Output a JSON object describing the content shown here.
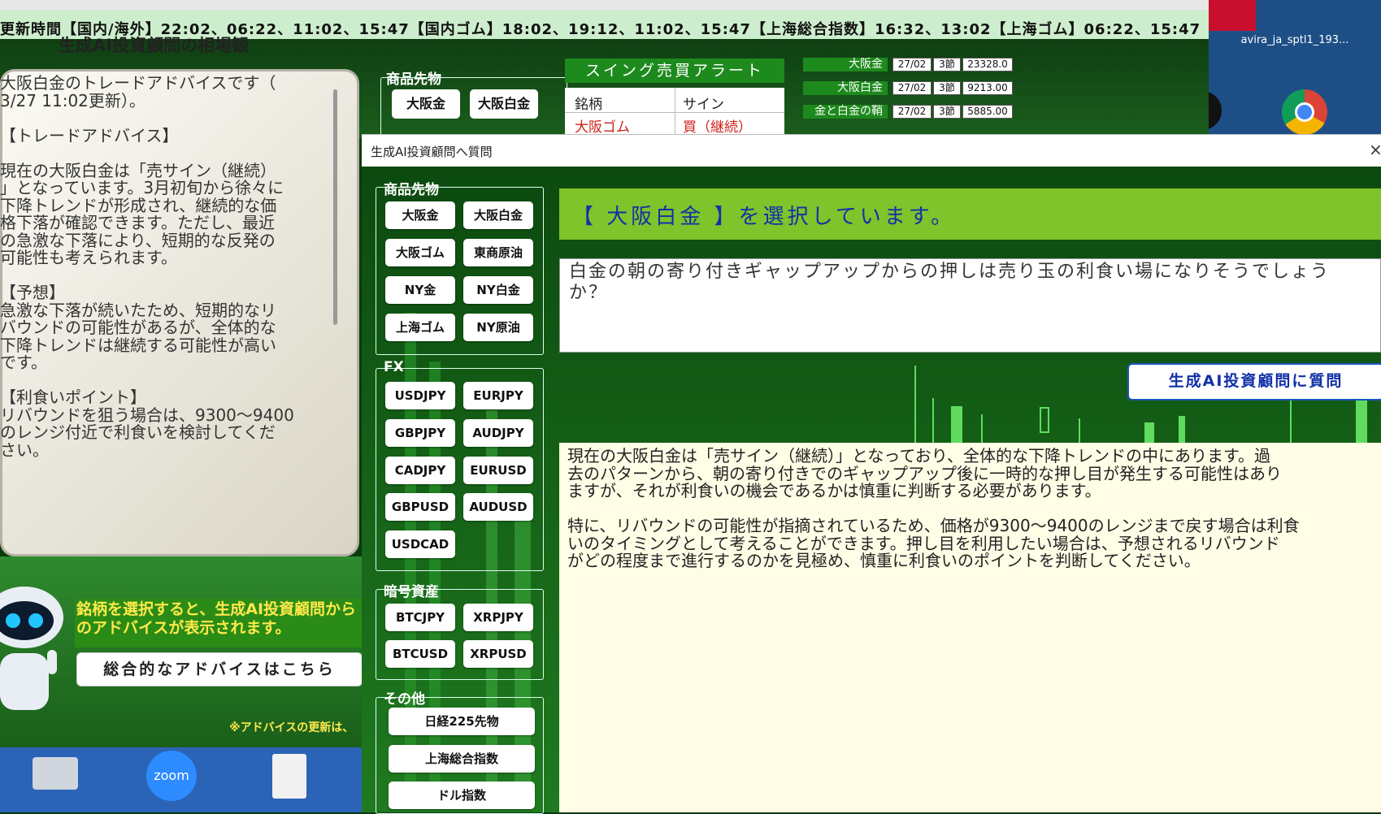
{
  "ticker": "更新時間【国内/海外】22:02、06:22、11:02、15:47【国内ゴム】18:02、19:12、11:02、15:47【上海総合指数】16:32、13:02【上海ゴム】06:22、15:47",
  "desktop": {
    "icon_label": "avira_ja_sptl1_193..."
  },
  "advice_panel": {
    "title": "生成AI投資顧問の相場観",
    "text": "大阪白金のトレードアドバイスです（\n3/27 11:02更新）。\n\n【トレードアドバイス】\n\n現在の大阪白金は「売サイン（継続）\n」となっています。3月初旬から徐々に\n下降トレンドが形成され、継続的な価\n格下落が確認できます。ただし、最近\nの急激な下落により、短期的な反発の\n可能性も考えられます。\n\n【予想】\n急激な下落が続いたため、短期的なリ\nバウンドの可能性があるが、全体的な\n下降トレンドは継続する可能性が高い\nです。\n\n【利食いポイント】\nリバウンドを狙う場合は、9300〜9400\nのレンジ付近で利食いを検討してくだ\nさい。"
  },
  "hint": {
    "text": "銘柄を選択すると、生成AI投資顧問からのアドバイスが表示されます。",
    "overall_button": "総合的なアドバイスはこちら",
    "note": "※アドバイスの更新は、"
  },
  "taskbar": {
    "zoom_label": "zoom"
  },
  "bg_products": {
    "label": "商品先物",
    "buttons": [
      "大阪金",
      "大阪白金"
    ]
  },
  "swing": {
    "title": "スイング売買アラート",
    "col_name": "銘柄",
    "col_sign": "サイン",
    "row_name": "大阪ゴム",
    "row_sign": "買（継続）"
  },
  "prices": [
    {
      "name": "大阪金",
      "date": "27/02",
      "session": "3節",
      "value": "23328.0"
    },
    {
      "name": "大阪白金",
      "date": "27/02",
      "session": "3節",
      "value": "9213.00"
    },
    {
      "name": "金と白金の鞘",
      "date": "27/02",
      "session": "3節",
      "value": "5885.00"
    }
  ],
  "dialog": {
    "title": "生成AI投資顧問へ質問",
    "close": "×",
    "groups": {
      "futures": {
        "label": "商品先物",
        "buttons": [
          "大阪金",
          "大阪白金",
          "大阪ゴム",
          "東商原油",
          "NY金",
          "NY白金",
          "上海ゴム",
          "NY原油"
        ]
      },
      "fx": {
        "label": "FX",
        "buttons": [
          "USDJPY",
          "EURJPY",
          "GBPJPY",
          "AUDJPY",
          "CADJPY",
          "EURUSD",
          "GBPUSD",
          "AUDUSD",
          "USDCAD"
        ]
      },
      "crypto": {
        "label": "暗号資産",
        "buttons": [
          "BTCJPY",
          "XRPJPY",
          "BTCUSD",
          "XRPUSD"
        ]
      },
      "other": {
        "label": "その他",
        "buttons": [
          "日経225先物",
          "上海総合指数",
          "ドル指数"
        ]
      }
    },
    "selected": "【 大阪白金 】を選択しています。",
    "question": "白金の朝の寄り付きギャップアップからの押しは売り玉の利食い場になりそうでしょうか？",
    "ask_button": "生成AI投資顧問に質問",
    "answer": "現在の大阪白金は「売サイン（継続）」となっており、全体的な下降トレンドの中にあります。過\n去のパターンから、朝の寄り付きでのギャップアップ後に一時的な押し目が発生する可能性はあり\nますが、それが利食いの機会であるかは慎重に判断する必要があります。\n\n特に、リバウンドの可能性が指摘されているため、価格が9300〜9400のレンジまで戻す場合は利食\nいのタイミングとして考えることができます。押し目を利用したい場合は、予想されるリバウンド\nがどの程度まで進行するのかを見極め、慎重に利食いのポイントを判断してください。"
  },
  "colors": {
    "banner": "#7ec42a",
    "selected_text": "#1230a8",
    "sell_red": "#d0201a",
    "hint_yellow": "#ffe94a"
  }
}
